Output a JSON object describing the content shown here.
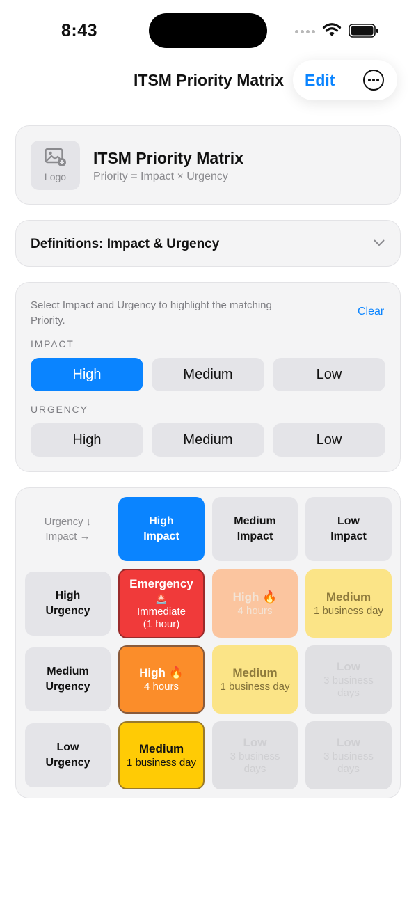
{
  "status": {
    "time": "8:43"
  },
  "nav": {
    "title": "ITSM Priority Matrix",
    "edit_label": "Edit"
  },
  "header": {
    "logo_label": "Logo",
    "title": "ITSM Priority Matrix",
    "subtitle": "Priority = Impact × Urgency"
  },
  "definitions": {
    "title": "Definitions: Impact & Urgency"
  },
  "selector": {
    "instructions": "Select Impact and Urgency to highlight the matching Priority.",
    "clear_label": "Clear",
    "impact_label": "IMPACT",
    "urgency_label": "URGENCY",
    "impact_options": [
      "High",
      "Medium",
      "Low"
    ],
    "urgency_options": [
      "High",
      "Medium",
      "Low"
    ],
    "selected_impact": "High",
    "selected_urgency": null
  },
  "matrix": {
    "corner": {
      "line1": "Urgency ↓",
      "line2": "Impact →"
    },
    "columns": [
      {
        "line1": "High",
        "line2": "Impact"
      },
      {
        "line1": "Medium",
        "line2": "Impact"
      },
      {
        "line1": "Low",
        "line2": "Impact"
      }
    ],
    "rows": [
      {
        "header": {
          "line1": "High",
          "line2": "Urgency"
        },
        "cells": [
          {
            "title": "Emergency",
            "icon": "🚨",
            "sub1": "Immediate",
            "sub2": "(1 hour)"
          },
          {
            "title": "High 🔥",
            "sub1": "4 hours"
          },
          {
            "title": "Medium",
            "sub1": "1 business day"
          }
        ]
      },
      {
        "header": {
          "line1": "Medium",
          "line2": "Urgency"
        },
        "cells": [
          {
            "title": "High 🔥",
            "sub1": "4 hours"
          },
          {
            "title": "Medium",
            "sub1": "1 business day"
          },
          {
            "title": "Low",
            "sub1": "3 business",
            "sub2": "days"
          }
        ]
      },
      {
        "header": {
          "line1": "Low",
          "line2": "Urgency"
        },
        "cells": [
          {
            "title": "Medium",
            "sub1": "1 business day"
          },
          {
            "title": "Low",
            "sub1": "3 business",
            "sub2": "days"
          },
          {
            "title": "Low",
            "sub1": "3 business",
            "sub2": "days"
          }
        ]
      }
    ]
  },
  "colors": {
    "accent": "#0a84ff",
    "emergency": "#f03a3a",
    "high": "#fb8d2a",
    "medium": "#ffcb05",
    "low": "#e0e0e3"
  }
}
